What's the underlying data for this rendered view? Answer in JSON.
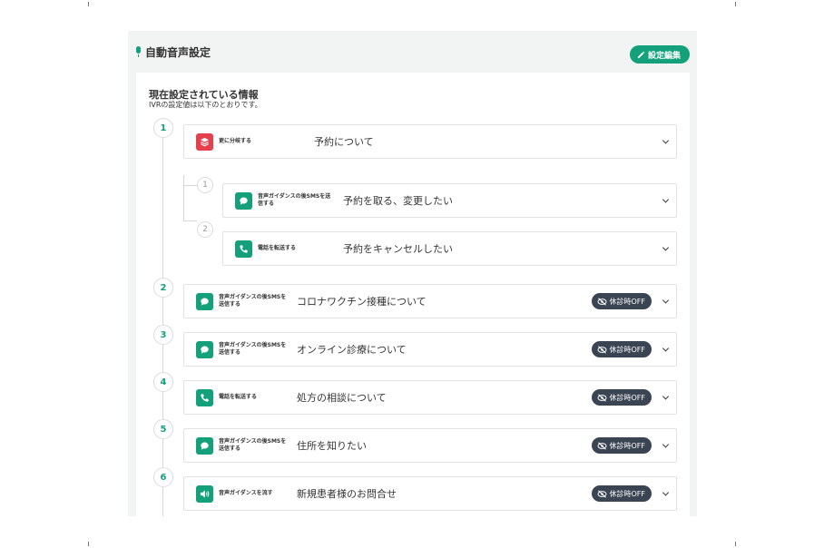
{
  "header": {
    "title": "自動音声設定",
    "edit_label": "設定編集"
  },
  "info": {
    "title": "現在設定されている情報",
    "subtitle": "IVRの設定値は以下のとおりです。"
  },
  "steps": [
    {
      "number": "1",
      "type": "更に分岐する",
      "label": "予約について",
      "icon": "layers-icon",
      "color": "#e5404d"
    },
    {
      "number": "1",
      "type": "音声ガイダンスの後SMSを送信する",
      "label": "予約を取る、変更したい",
      "icon": "speech-bubble-icon"
    },
    {
      "number": "2",
      "type": "電話を転送する",
      "label": "予約をキャンセルしたい",
      "icon": "phone-icon"
    },
    {
      "number": "2",
      "type": "音声ガイダンスの後SMSを送信する",
      "label": "コロナワクチン接種について",
      "icon": "speech-bubble-icon",
      "badge": "休診時OFF"
    },
    {
      "number": "3",
      "type": "音声ガイダンスの後SMSを送信する",
      "label": "オンライン診療について",
      "icon": "speech-bubble-icon",
      "badge": "休診時OFF"
    },
    {
      "number": "4",
      "type": "電話を転送する",
      "label": "処方の相談について",
      "icon": "phone-icon",
      "badge": "休診時OFF"
    },
    {
      "number": "5",
      "type": "音声ガイダンスの後SMSを送信する",
      "label": "住所を知りたい",
      "icon": "speech-bubble-icon",
      "badge": "休診時OFF"
    },
    {
      "number": "6",
      "type": "音声ガイダンスを流す",
      "label": "新規患者様のお問合せ",
      "icon": "speaker-icon",
      "badge": "休診時OFF"
    }
  ],
  "colors": {
    "accent": "#13a07a",
    "branch": "#e5404d",
    "badge": "#3b4452"
  }
}
